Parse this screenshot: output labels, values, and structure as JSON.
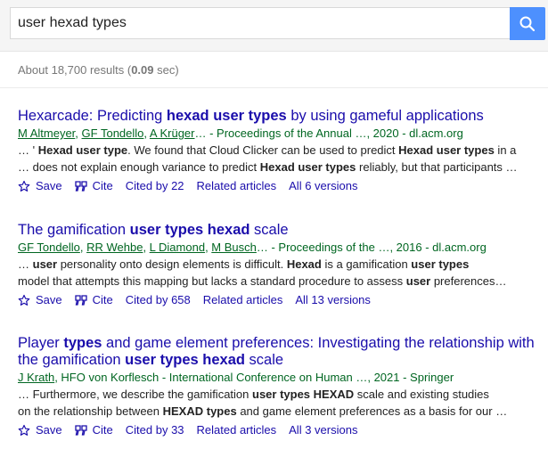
{
  "search": {
    "query": "user hexad types",
    "button_icon": "search-icon"
  },
  "stats": {
    "prefix": "About 18,700 results (",
    "time": "0.09",
    "suffix": " sec)"
  },
  "colors": {
    "title": "#1a0dab",
    "authors": "#006621",
    "search_button": "#4d90fe",
    "stats": "#777777"
  },
  "results": [
    {
      "title_parts": [
        {
          "text": "Hexarcade: Predicting ",
          "bold": false
        },
        {
          "text": "hexad user types",
          "bold": true
        },
        {
          "text": " by using gameful applications",
          "bold": false
        }
      ],
      "authors": [
        {
          "text": "M Altmeyer",
          "link": true
        },
        {
          "text": ", ",
          "link": false
        },
        {
          "text": "GF Tondello",
          "link": true
        },
        {
          "text": ", ",
          "link": false
        },
        {
          "text": "A Krüger",
          "link": true
        },
        {
          "text": "… - Proceedings of the Annual …, 2020 - dl.acm.org",
          "link": false
        }
      ],
      "snippet_lines": [
        [
          {
            "text": "… ' ",
            "bold": false
          },
          {
            "text": "Hexad user type",
            "bold": true
          },
          {
            "text": ". We found that Cloud Clicker can be used to predict ",
            "bold": false
          },
          {
            "text": "Hexad user types",
            "bold": true
          },
          {
            "text": " in a",
            "bold": false
          }
        ],
        [
          {
            "text": "… does not explain enough variance to predict ",
            "bold": false
          },
          {
            "text": "Hexad user types",
            "bold": true
          },
          {
            "text": " reliably, but that participants …",
            "bold": false
          }
        ]
      ],
      "save": "Save",
      "cite": "Cite",
      "cited_by": "Cited by 22",
      "related": "Related articles",
      "versions": "All 6 versions"
    },
    {
      "title_parts": [
        {
          "text": "The gamification ",
          "bold": false
        },
        {
          "text": "user types hexad",
          "bold": true
        },
        {
          "text": " scale",
          "bold": false
        }
      ],
      "authors": [
        {
          "text": "GF Tondello",
          "link": true
        },
        {
          "text": ", ",
          "link": false
        },
        {
          "text": "RR Wehbe",
          "link": true
        },
        {
          "text": ", ",
          "link": false
        },
        {
          "text": "L Diamond",
          "link": true
        },
        {
          "text": ", ",
          "link": false
        },
        {
          "text": "M Busch",
          "link": true
        },
        {
          "text": "… - Proceedings of the …, 2016 - dl.acm.org",
          "link": false
        }
      ],
      "snippet_lines": [
        [
          {
            "text": "… ",
            "bold": false
          },
          {
            "text": "user",
            "bold": true
          },
          {
            "text": " personality onto design elements is difficult. ",
            "bold": false
          },
          {
            "text": "Hexad",
            "bold": true
          },
          {
            "text": " is a gamification ",
            "bold": false
          },
          {
            "text": "user types",
            "bold": true
          }
        ],
        [
          {
            "text": "model that attempts this mapping but lacks a standard procedure to assess ",
            "bold": false
          },
          {
            "text": "user",
            "bold": true
          },
          {
            "text": " preferences…",
            "bold": false
          }
        ]
      ],
      "save": "Save",
      "cite": "Cite",
      "cited_by": "Cited by 658",
      "related": "Related articles",
      "versions": "All 13 versions"
    },
    {
      "title_parts": [
        {
          "text": "Player ",
          "bold": false
        },
        {
          "text": "types",
          "bold": true
        },
        {
          "text": " and game element preferences: Investigating the relationship with",
          "bold": false
        },
        {
          "text": "\n",
          "bold": false
        },
        {
          "text": "the gamification ",
          "bold": false
        },
        {
          "text": "user types hexad",
          "bold": true
        },
        {
          "text": " scale",
          "bold": false
        }
      ],
      "authors": [
        {
          "text": "J Krath",
          "link": true
        },
        {
          "text": ", HFO von Korflesch - International Conference on Human …, 2021 - Springer",
          "link": false
        }
      ],
      "snippet_lines": [
        [
          {
            "text": "… Furthermore, we describe the gamification ",
            "bold": false
          },
          {
            "text": "user types HEXAD",
            "bold": true
          },
          {
            "text": " scale and existing studies",
            "bold": false
          }
        ],
        [
          {
            "text": "on the relationship between ",
            "bold": false
          },
          {
            "text": "HEXAD types",
            "bold": true
          },
          {
            "text": " and game element preferences as a basis for our …",
            "bold": false
          }
        ]
      ],
      "save": "Save",
      "cite": "Cite",
      "cited_by": "Cited by 33",
      "related": "Related articles",
      "versions": "All 3 versions"
    }
  ]
}
